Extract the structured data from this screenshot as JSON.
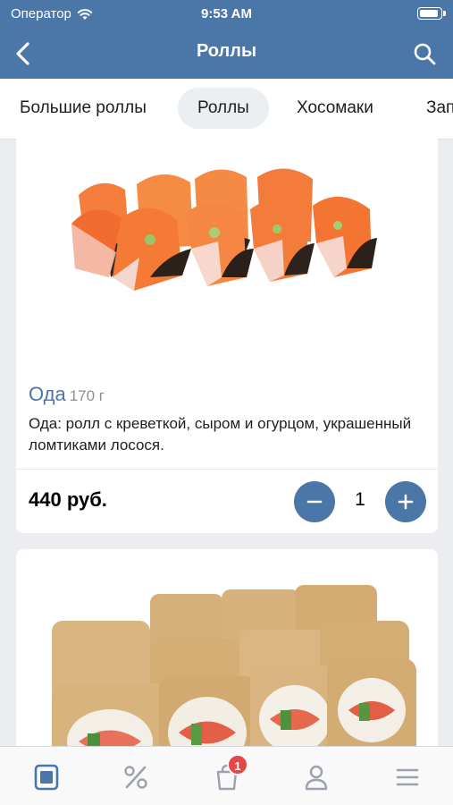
{
  "status_bar": {
    "carrier": "Оператор",
    "time": "9:53 AM"
  },
  "nav": {
    "title": "Роллы",
    "back_icon": "chevron-left-icon",
    "search_icon": "search-icon"
  },
  "categories": [
    "Большие роллы",
    "Роллы",
    "Хосомаки",
    "Зап"
  ],
  "active_category": "Роллы",
  "products": [
    {
      "name": "Ода",
      "weight": "170 г",
      "description": "Ода: ролл с креветкой, сыром и огурцом, украшенный ломтиками лосося.",
      "price": "440 руб.",
      "quantity": "1"
    }
  ],
  "tabbar": {
    "items": [
      "menu-icon",
      "percent-icon",
      "cart-icon",
      "profile-icon",
      "hamburger-icon"
    ],
    "cart_badge": "1",
    "active_color": "#4a76a8",
    "inactive_color": "#99a2ad"
  },
  "colors": {
    "brand": "#4a76a8",
    "background": "#ebedf0",
    "badge": "#e64646"
  }
}
